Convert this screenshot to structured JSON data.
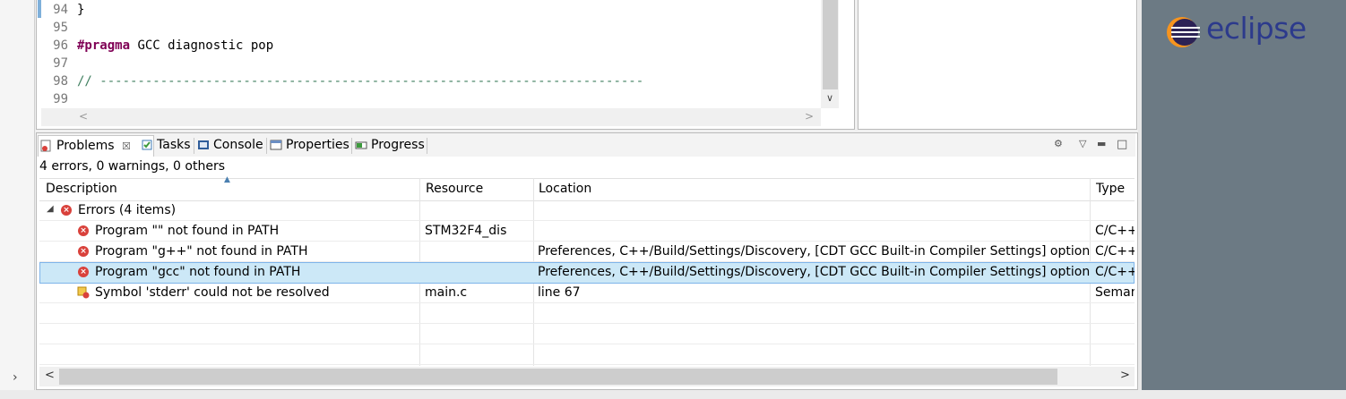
{
  "editor": {
    "lines": [
      {
        "num": "94",
        "code": "}"
      },
      {
        "num": "95",
        "code": ""
      },
      {
        "num": "96",
        "keyword": "#pragma",
        "code": " GCC diagnostic pop"
      },
      {
        "num": "97",
        "code": ""
      },
      {
        "num": "98",
        "comment": "// ------------------------------------------------------------------------"
      },
      {
        "num": "99",
        "code": ""
      }
    ]
  },
  "brand": {
    "name": "eclipse"
  },
  "tabs": [
    {
      "label": "Problems",
      "active": true,
      "close": "☒"
    },
    {
      "label": "Tasks"
    },
    {
      "label": "Console"
    },
    {
      "label": "Properties"
    },
    {
      "label": "Progress"
    }
  ],
  "summary": "4 errors, 0 warnings, 0 others",
  "columns": [
    "Description",
    "Resource",
    "Location",
    "Type"
  ],
  "group": {
    "label": "Errors (4 items)",
    "icon": "error-icon"
  },
  "rows": [
    {
      "description": "Program \"\" not found in PATH",
      "resource": "STM32F4_dis",
      "location": "",
      "type": "C/C++",
      "icon": "error-icon"
    },
    {
      "description": "Program \"g++\" not found in PATH",
      "resource": "",
      "location": "Preferences, C++/Build/Settings/Discovery, [CDT GCC Built-in Compiler Settings] options",
      "type": "C/C++",
      "icon": "error-icon"
    },
    {
      "description": "Program \"gcc\" not found in PATH",
      "resource": "",
      "location": "Preferences, C++/Build/Settings/Discovery, [CDT GCC Built-in Compiler Settings] options",
      "type": "C/C++",
      "icon": "error-icon",
      "selected": true
    },
    {
      "description": "Symbol 'stderr' could not be resolved",
      "resource": "main.c",
      "location": "line 67",
      "type": "Seman",
      "icon": "semantic-error-icon"
    }
  ],
  "colors": {
    "accent": "#6c7a84",
    "error": "#d9413b",
    "selection": "#cce8f7"
  }
}
